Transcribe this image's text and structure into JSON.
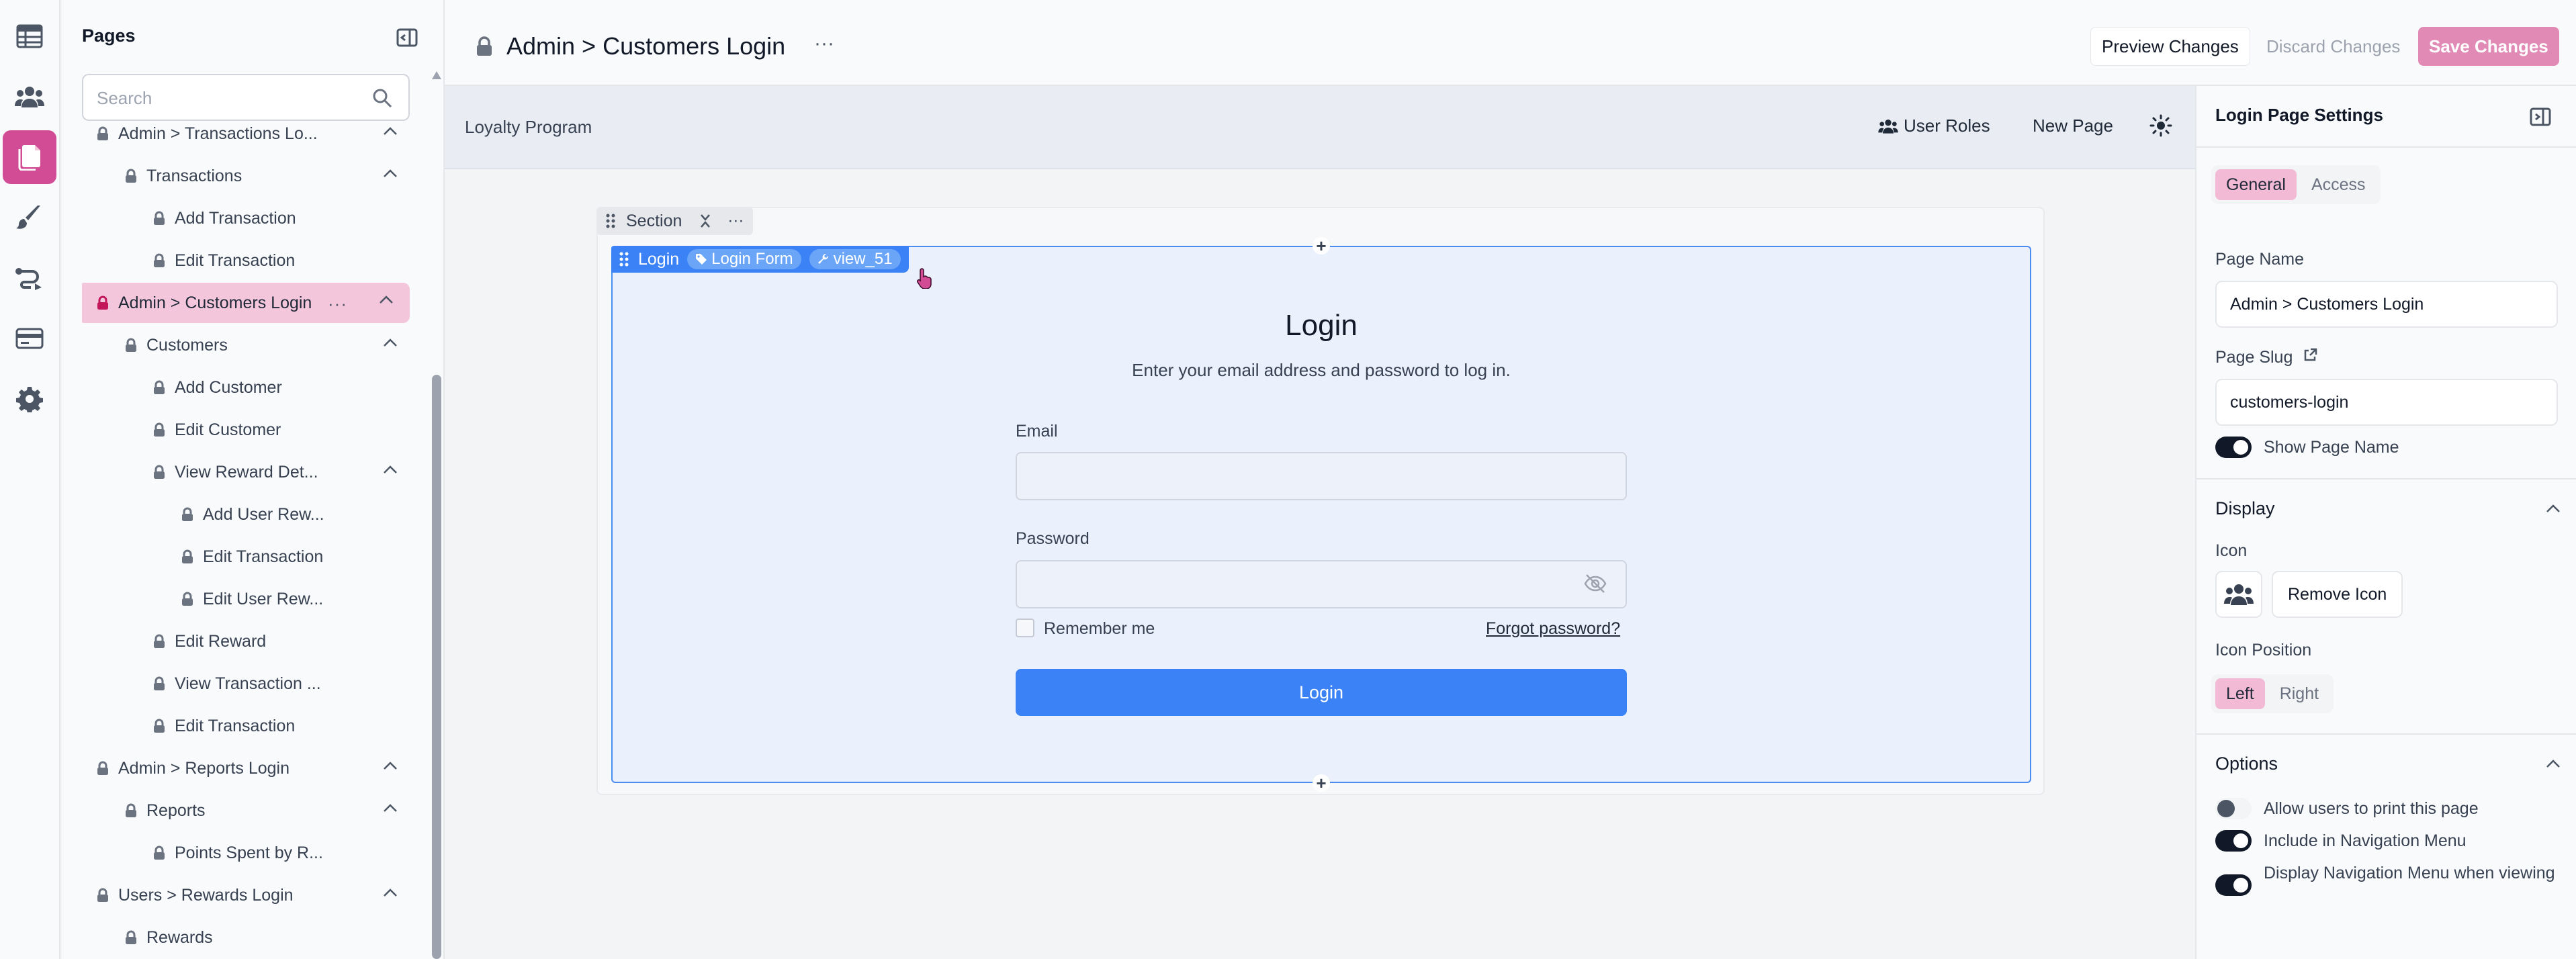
{
  "rail": {
    "items": [
      {
        "icon": "table-icon",
        "active": false
      },
      {
        "icon": "users-icon",
        "active": false
      },
      {
        "icon": "pages-icon",
        "active": true
      },
      {
        "icon": "brush-icon",
        "active": false
      },
      {
        "icon": "flows-icon",
        "active": false
      },
      {
        "icon": "payment-icon",
        "active": false
      },
      {
        "icon": "gear-icon",
        "active": false
      }
    ],
    "active_color": "#d14c94"
  },
  "tree": {
    "title": "Pages",
    "search_placeholder": "Search",
    "rows": [
      {
        "label": "Admin > Transactions Lo...",
        "level": 0,
        "chevron": true
      },
      {
        "label": "Transactions",
        "level": 1,
        "chevron": true
      },
      {
        "label": "Add Transaction",
        "level": 2,
        "chevron": false
      },
      {
        "label": "Edit Transaction",
        "level": 2,
        "chevron": false
      },
      {
        "label": "Admin > Customers Login",
        "level": 0,
        "chevron": true,
        "selected": true
      },
      {
        "label": "Customers",
        "level": 1,
        "chevron": true
      },
      {
        "label": "Add Customer",
        "level": 2,
        "chevron": false
      },
      {
        "label": "Edit Customer",
        "level": 2,
        "chevron": false
      },
      {
        "label": "View Reward Det...",
        "level": 2,
        "chevron": true
      },
      {
        "label": "Add User Rew...",
        "level": 3,
        "chevron": false
      },
      {
        "label": "Edit Transaction",
        "level": 3,
        "chevron": false
      },
      {
        "label": "Edit User Rew...",
        "level": 3,
        "chevron": false
      },
      {
        "label": "Edit Reward",
        "level": 2,
        "chevron": false
      },
      {
        "label": "View Transaction ...",
        "level": 2,
        "chevron": false
      },
      {
        "label": "Edit Transaction",
        "level": 2,
        "chevron": false
      },
      {
        "label": "Admin > Reports Login",
        "level": 0,
        "chevron": true
      },
      {
        "label": "Reports",
        "level": 1,
        "chevron": true
      },
      {
        "label": "Points Spent by R...",
        "level": 2,
        "chevron": false
      },
      {
        "label": "Users > Rewards Login",
        "level": 0,
        "chevron": true
      },
      {
        "label": "Rewards",
        "level": 1,
        "chevron": false
      }
    ]
  },
  "header": {
    "title": "Admin > Customers Login",
    "more": "···",
    "preview_label": "Preview Changes",
    "discard_label": "Discard Changes",
    "save_label": "Save Changes"
  },
  "canvas": {
    "app_title": "Loyalty Program",
    "nav_user_roles": "User Roles",
    "nav_new_page": "New Page",
    "section_label": "Section",
    "block_label": "Login",
    "block_pill_form": "Login Form",
    "block_pill_view": "view_51",
    "login": {
      "title": "Login",
      "subtitle": "Enter your email address and password to log in.",
      "email_label": "Email",
      "email_value": "",
      "password_label": "Password",
      "password_value": "",
      "remember_label": "Remember me",
      "forgot_label": "Forgot password?",
      "button_label": "Login"
    }
  },
  "settings": {
    "title": "Login Page Settings",
    "tab_general": "General",
    "tab_access": "Access",
    "page_name_label": "Page Name",
    "page_name_value": "Admin > Customers Login",
    "page_slug_label": "Page Slug",
    "page_slug_value": "customers-login",
    "show_page_name_label": "Show Page Name",
    "display_heading": "Display",
    "icon_label": "Icon",
    "remove_icon_label": "Remove Icon",
    "icon_position_label": "Icon Position",
    "pos_left": "Left",
    "pos_right": "Right",
    "options_heading": "Options",
    "opt_print_label": "Allow users to print this page",
    "opt_nav_label": "Include in Navigation Menu",
    "opt_display_nav_label": "Display Navigation Menu when viewing"
  },
  "colors": {
    "accent": "#d14c94",
    "selection": "#f4c6dc",
    "primary_blue": "#3b82f6",
    "save_button": "#e08ab5"
  }
}
